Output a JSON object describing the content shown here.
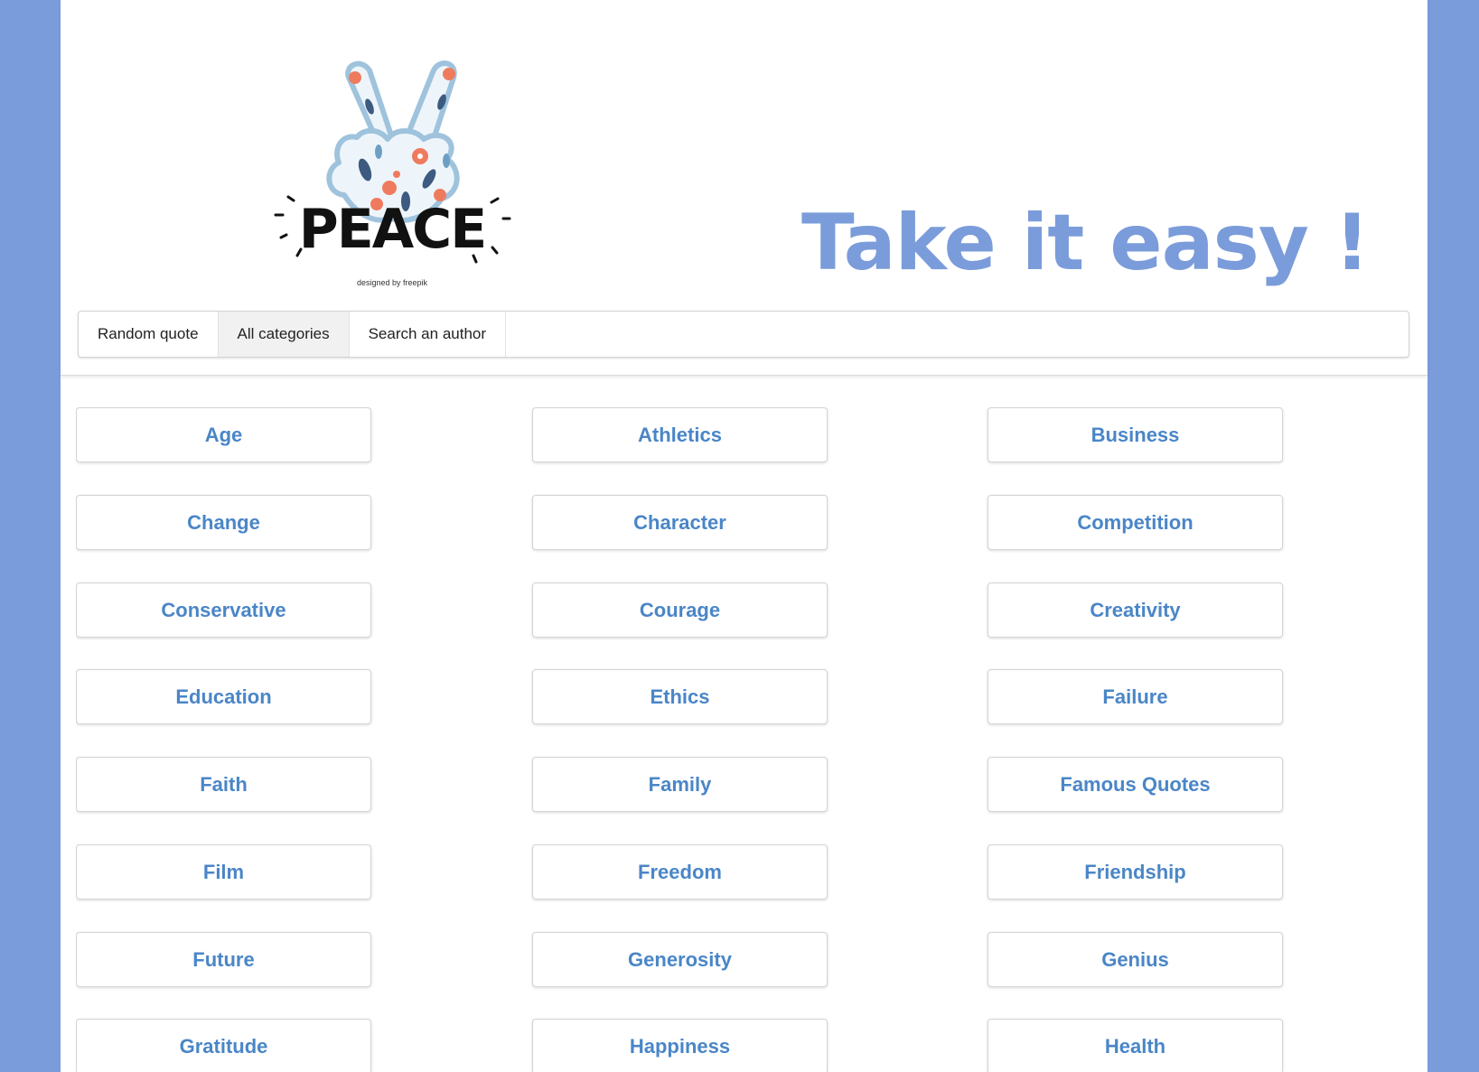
{
  "header": {
    "title": "Take it easy !",
    "logo_text": "PEACE",
    "logo_credit": "designed by freepik"
  },
  "menu": {
    "items": [
      {
        "label": "Random quote",
        "active": false
      },
      {
        "label": "All categories",
        "active": true
      },
      {
        "label": "Search an author",
        "active": false
      }
    ]
  },
  "categories": [
    "Age",
    "Athletics",
    "Business",
    "Change",
    "Character",
    "Competition",
    "Conservative",
    "Courage",
    "Creativity",
    "Education",
    "Ethics",
    "Failure",
    "Faith",
    "Family",
    "Famous Quotes",
    "Film",
    "Freedom",
    "Friendship",
    "Future",
    "Generosity",
    "Genius",
    "Gratitude",
    "Happiness",
    "Health"
  ],
  "colors": {
    "background": "#7b9cda",
    "title": "#7b9cda",
    "category_text": "#4a86c7",
    "logo_hand_outline": "#9fc3dc",
    "logo_accent": "#ef7b5f",
    "logo_leaf": "#3d5a80"
  }
}
